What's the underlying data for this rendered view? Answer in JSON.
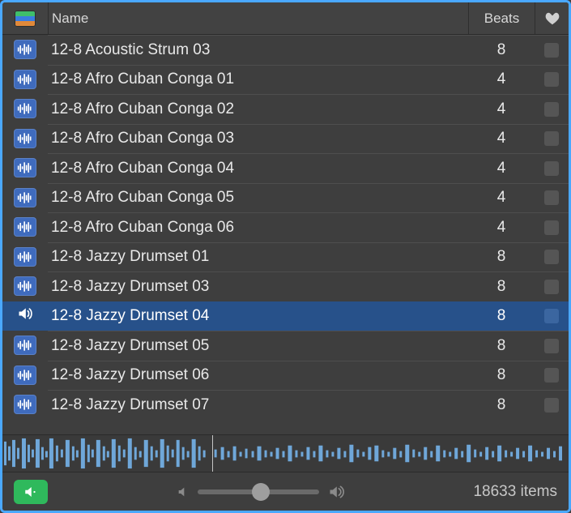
{
  "header": {
    "name_label": "Name",
    "beats_label": "Beats"
  },
  "rows": [
    {
      "name": "12-8 Acoustic Strum 03",
      "beats": "8",
      "selected": false
    },
    {
      "name": "12-8 Afro Cuban Conga 01",
      "beats": "4",
      "selected": false
    },
    {
      "name": "12-8 Afro Cuban Conga 02",
      "beats": "4",
      "selected": false
    },
    {
      "name": "12-8 Afro Cuban Conga 03",
      "beats": "4",
      "selected": false
    },
    {
      "name": "12-8 Afro Cuban Conga 04",
      "beats": "4",
      "selected": false
    },
    {
      "name": "12-8 Afro Cuban Conga 05",
      "beats": "4",
      "selected": false
    },
    {
      "name": "12-8 Afro Cuban Conga 06",
      "beats": "4",
      "selected": false
    },
    {
      "name": "12-8 Jazzy Drumset 01",
      "beats": "8",
      "selected": false
    },
    {
      "name": "12-8 Jazzy Drumset 03",
      "beats": "8",
      "selected": false
    },
    {
      "name": "12-8 Jazzy Drumset 04",
      "beats": "8",
      "selected": true
    },
    {
      "name": "12-8 Jazzy Drumset 05",
      "beats": "8",
      "selected": false
    },
    {
      "name": "12-8 Jazzy Drumset 06",
      "beats": "8",
      "selected": false
    },
    {
      "name": "12-8 Jazzy Drumset 07",
      "beats": "8",
      "selected": false
    }
  ],
  "waveform": {
    "playhead_percent": 37
  },
  "footer": {
    "volume_percent": 52,
    "item_count": "18633 items"
  }
}
